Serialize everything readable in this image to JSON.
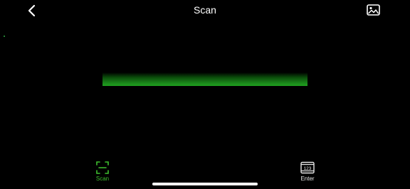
{
  "header": {
    "title": "Scan",
    "back_icon": "chevron-left-icon",
    "gallery_icon": "image-icon"
  },
  "scanner": {
    "line_color": "#1e9e1e"
  },
  "tabs": [
    {
      "label": "Scan",
      "icon": "scan-frame-icon",
      "active": true,
      "color": "#3fbf2f"
    },
    {
      "label": "Enter",
      "icon": "keypad-123-icon",
      "active": false,
      "color": "#e6e6e6"
    }
  ],
  "tab_icon_text": {
    "enter": "123"
  }
}
